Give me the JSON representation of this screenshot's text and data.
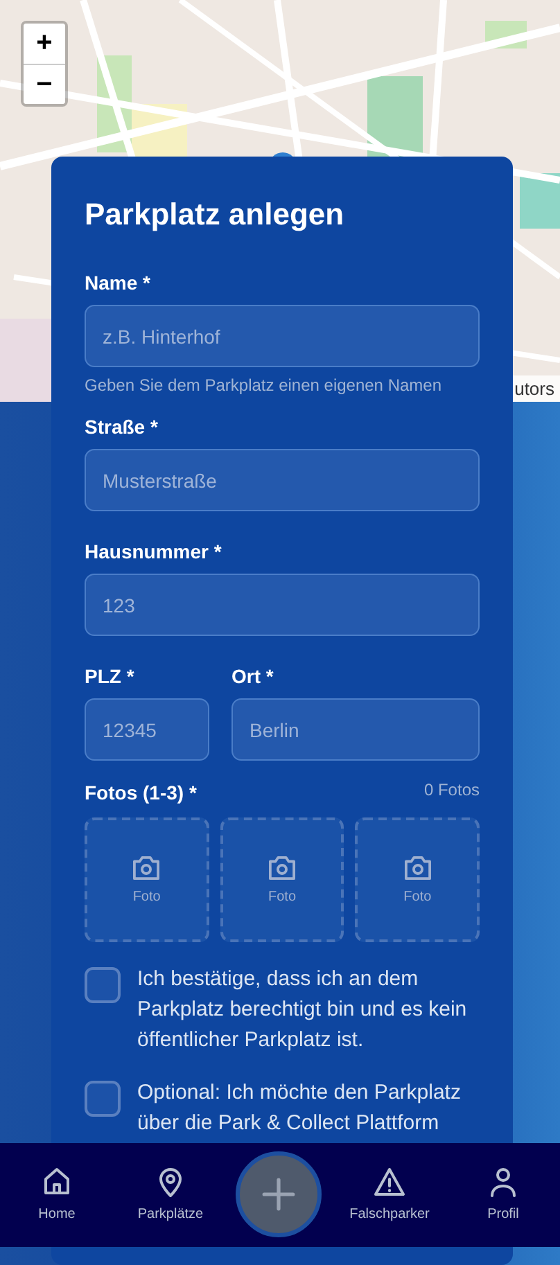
{
  "map": {
    "kind": "picture",
    "zoom_controls": [
      "+",
      "−"
    ],
    "attribution": "utors"
  },
  "form": {
    "title": "Parkplatz anlegen",
    "fields": [
      {
        "label": "Name *",
        "placeholder": "z.B. Hinterhof",
        "hint": "Geben Sie dem Parkplatz einen eigenen Namen"
      },
      {
        "label": "Straße *",
        "placeholder": "Musterstraße"
      },
      {
        "label": "Hausnummer *",
        "placeholder": "123"
      }
    ],
    "row_fields": [
      {
        "label": "PLZ *",
        "placeholder": "12345"
      },
      {
        "label": "Ort *",
        "placeholder": "Berlin"
      }
    ],
    "photos": {
      "label": "Fotos (1-3) *",
      "count": "0 Fotos",
      "slots": [
        "Foto",
        "Foto",
        "Foto"
      ]
    },
    "checkboxes": [
      {
        "text": "Ich bestätige, dass ich an dem Parkplatz berechtigt bin und es kein öffentlicher Parkplatz ist.",
        "checked": false
      },
      {
        "text": "Optional: Ich möchte den Parkplatz über die Park & Collect Plattform",
        "checked": false
      }
    ]
  },
  "nav": [
    {
      "kind": "home",
      "label": "Home"
    },
    {
      "kind": "pin",
      "label": "Parkplätze"
    },
    {
      "kind": "add"
    },
    {
      "kind": "warning",
      "label": "Falschparker"
    },
    {
      "kind": "person",
      "label": "Profil"
    }
  ]
}
